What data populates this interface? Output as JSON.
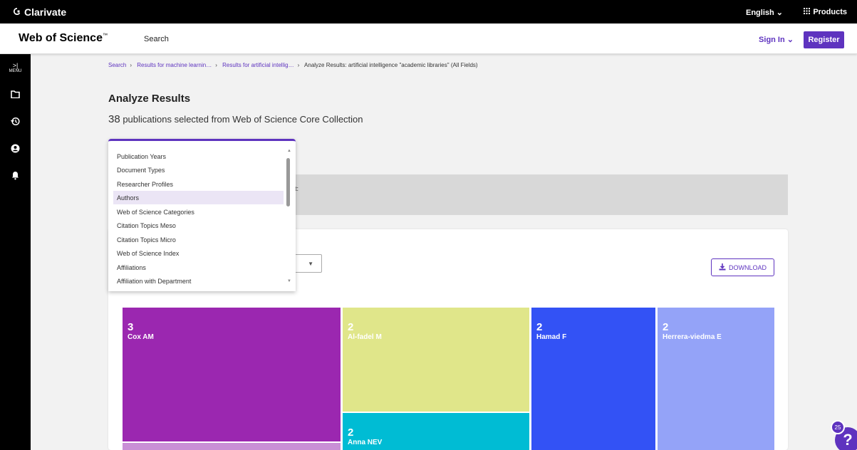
{
  "topbar": {
    "brand": "Clarivate",
    "language": "English",
    "products": "Products"
  },
  "header": {
    "product": "Web of Science",
    "trademark": "™",
    "search": "Search",
    "signin": "Sign In",
    "register": "Register"
  },
  "rail": {
    "menu_label": "MENU"
  },
  "breadcrumb": [
    "Search",
    "Results for machine learnin…",
    "Results for artificial intellig…",
    "Analyze Results: artificial intelligence \"academic libraries\" (All Fields)"
  ],
  "page": {
    "title": "Analyze Results",
    "count": "38",
    "subtitle": "publications selected from Web of Science Core Collection"
  },
  "greybox": {
    "trail": "t:"
  },
  "dropdown": {
    "options": [
      "Publication Years",
      "Document Types",
      "Researcher Profiles",
      "Authors",
      "Web of Science Categories",
      "Citation Topics Meso",
      "Citation Topics Micro",
      "Web of Science Index",
      "Affiliations",
      "Affiliation with Department"
    ],
    "highlighted": "Authors"
  },
  "download": {
    "label": "DOWNLOAD"
  },
  "treemap": [
    {
      "count": "3",
      "name": "Cox AM",
      "color": "#9b27b0"
    },
    {
      "count": "2",
      "name": "Al-fadel M",
      "color": "#e0e68a"
    },
    {
      "count": "2",
      "name": "Hamad F",
      "color": "#3352f5"
    },
    {
      "count": "2",
      "name": "Herrera-viedma E",
      "color": "#94a3f8"
    },
    {
      "count": "2",
      "name": "Anna NEV",
      "color": "#00bcd4"
    }
  ],
  "help": {
    "badge": "25",
    "symbol": "?"
  }
}
